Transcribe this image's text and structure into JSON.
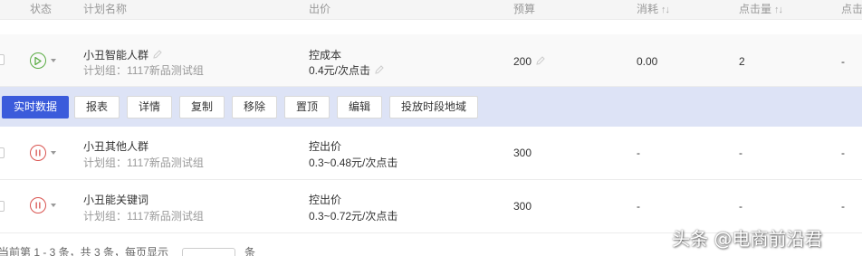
{
  "header": {
    "status": "状态",
    "plan_name": "计划名称",
    "bid": "出价",
    "budget": "预算",
    "spend": "消耗",
    "clicks": "点击量",
    "last": "点击"
  },
  "rows": [
    {
      "status": "running",
      "name": "小丑智能人群",
      "group": "计划组：1117新品测试组",
      "bid_type": "控成本",
      "bid_value": "0.4元/次点击",
      "budget": "200",
      "spend": "0.00",
      "clicks": "2",
      "last": "-"
    },
    {
      "status": "paused",
      "name": "小丑其他人群",
      "group": "计划组：1117新品测试组",
      "bid_type": "控出价",
      "bid_value": "0.3~0.48元/次点击",
      "budget": "300",
      "spend": "-",
      "clicks": "-",
      "last": "-"
    },
    {
      "status": "paused",
      "name": "小丑能关键词",
      "group": "计划组：1117新品测试组",
      "bid_type": "控出价",
      "bid_value": "0.3~0.72元/次点击",
      "budget": "300",
      "spend": "-",
      "clicks": "-",
      "last": "-"
    }
  ],
  "actions": {
    "realtime": "实时数据",
    "report": "报表",
    "detail": "详情",
    "copy": "复制",
    "remove": "移除",
    "pin": "置顶",
    "edit": "编辑",
    "schedule": "投放时段地域"
  },
  "footer": {
    "summary": "当前第 1 - 3 条，共 3 条，每页显示",
    "unit": "条"
  },
  "watermark": "头条 @电商前沿君",
  "colors": {
    "accent": "#3b5bdb",
    "action_bar_bg": "#dde3f6",
    "running": "#5aac44",
    "paused": "#d9534f"
  }
}
